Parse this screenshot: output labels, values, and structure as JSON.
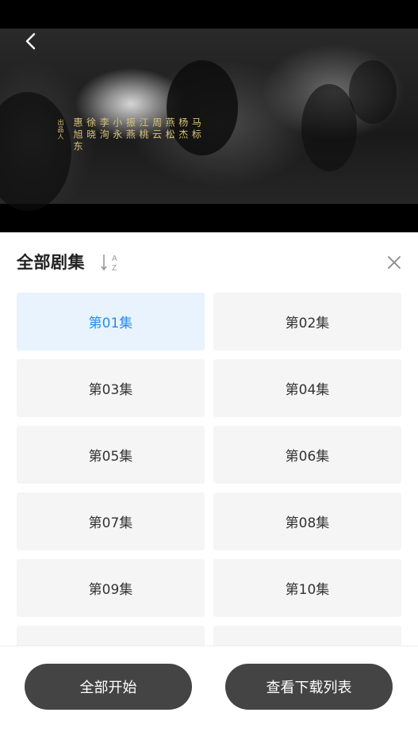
{
  "video": {
    "credits_label": "出品人",
    "credits": [
      "马标",
      "杨杰",
      "燕松",
      "周云",
      "江桃",
      "振燕",
      "小永",
      "李洵",
      "徐晓",
      "惠旭东"
    ]
  },
  "panel": {
    "title": "全部剧集",
    "sort_letters": [
      "A",
      "Z"
    ],
    "selected_episode": "第01集",
    "episodes": [
      {
        "label": "第01集",
        "selected": true
      },
      {
        "label": "第02集",
        "selected": false
      },
      {
        "label": "第03集",
        "selected": false
      },
      {
        "label": "第04集",
        "selected": false
      },
      {
        "label": "第05集",
        "selected": false
      },
      {
        "label": "第06集",
        "selected": false
      },
      {
        "label": "第07集",
        "selected": false
      },
      {
        "label": "第08集",
        "selected": false
      },
      {
        "label": "第09集",
        "selected": false
      },
      {
        "label": "第10集",
        "selected": false
      },
      {
        "label": "",
        "selected": false
      },
      {
        "label": "",
        "selected": false
      }
    ]
  },
  "footer": {
    "start_all": "全部开始",
    "view_list": "查看下载列表"
  },
  "colors": {
    "accent": "#2a8be8",
    "selected_bg": "#e8f3fd",
    "tile_bg": "#f5f5f5",
    "button_bg": "#444444",
    "credits_text": "#d9c27a"
  },
  "icons": {
    "back": "chevron-left-icon",
    "sort": "sort-az-icon",
    "close": "close-icon"
  }
}
